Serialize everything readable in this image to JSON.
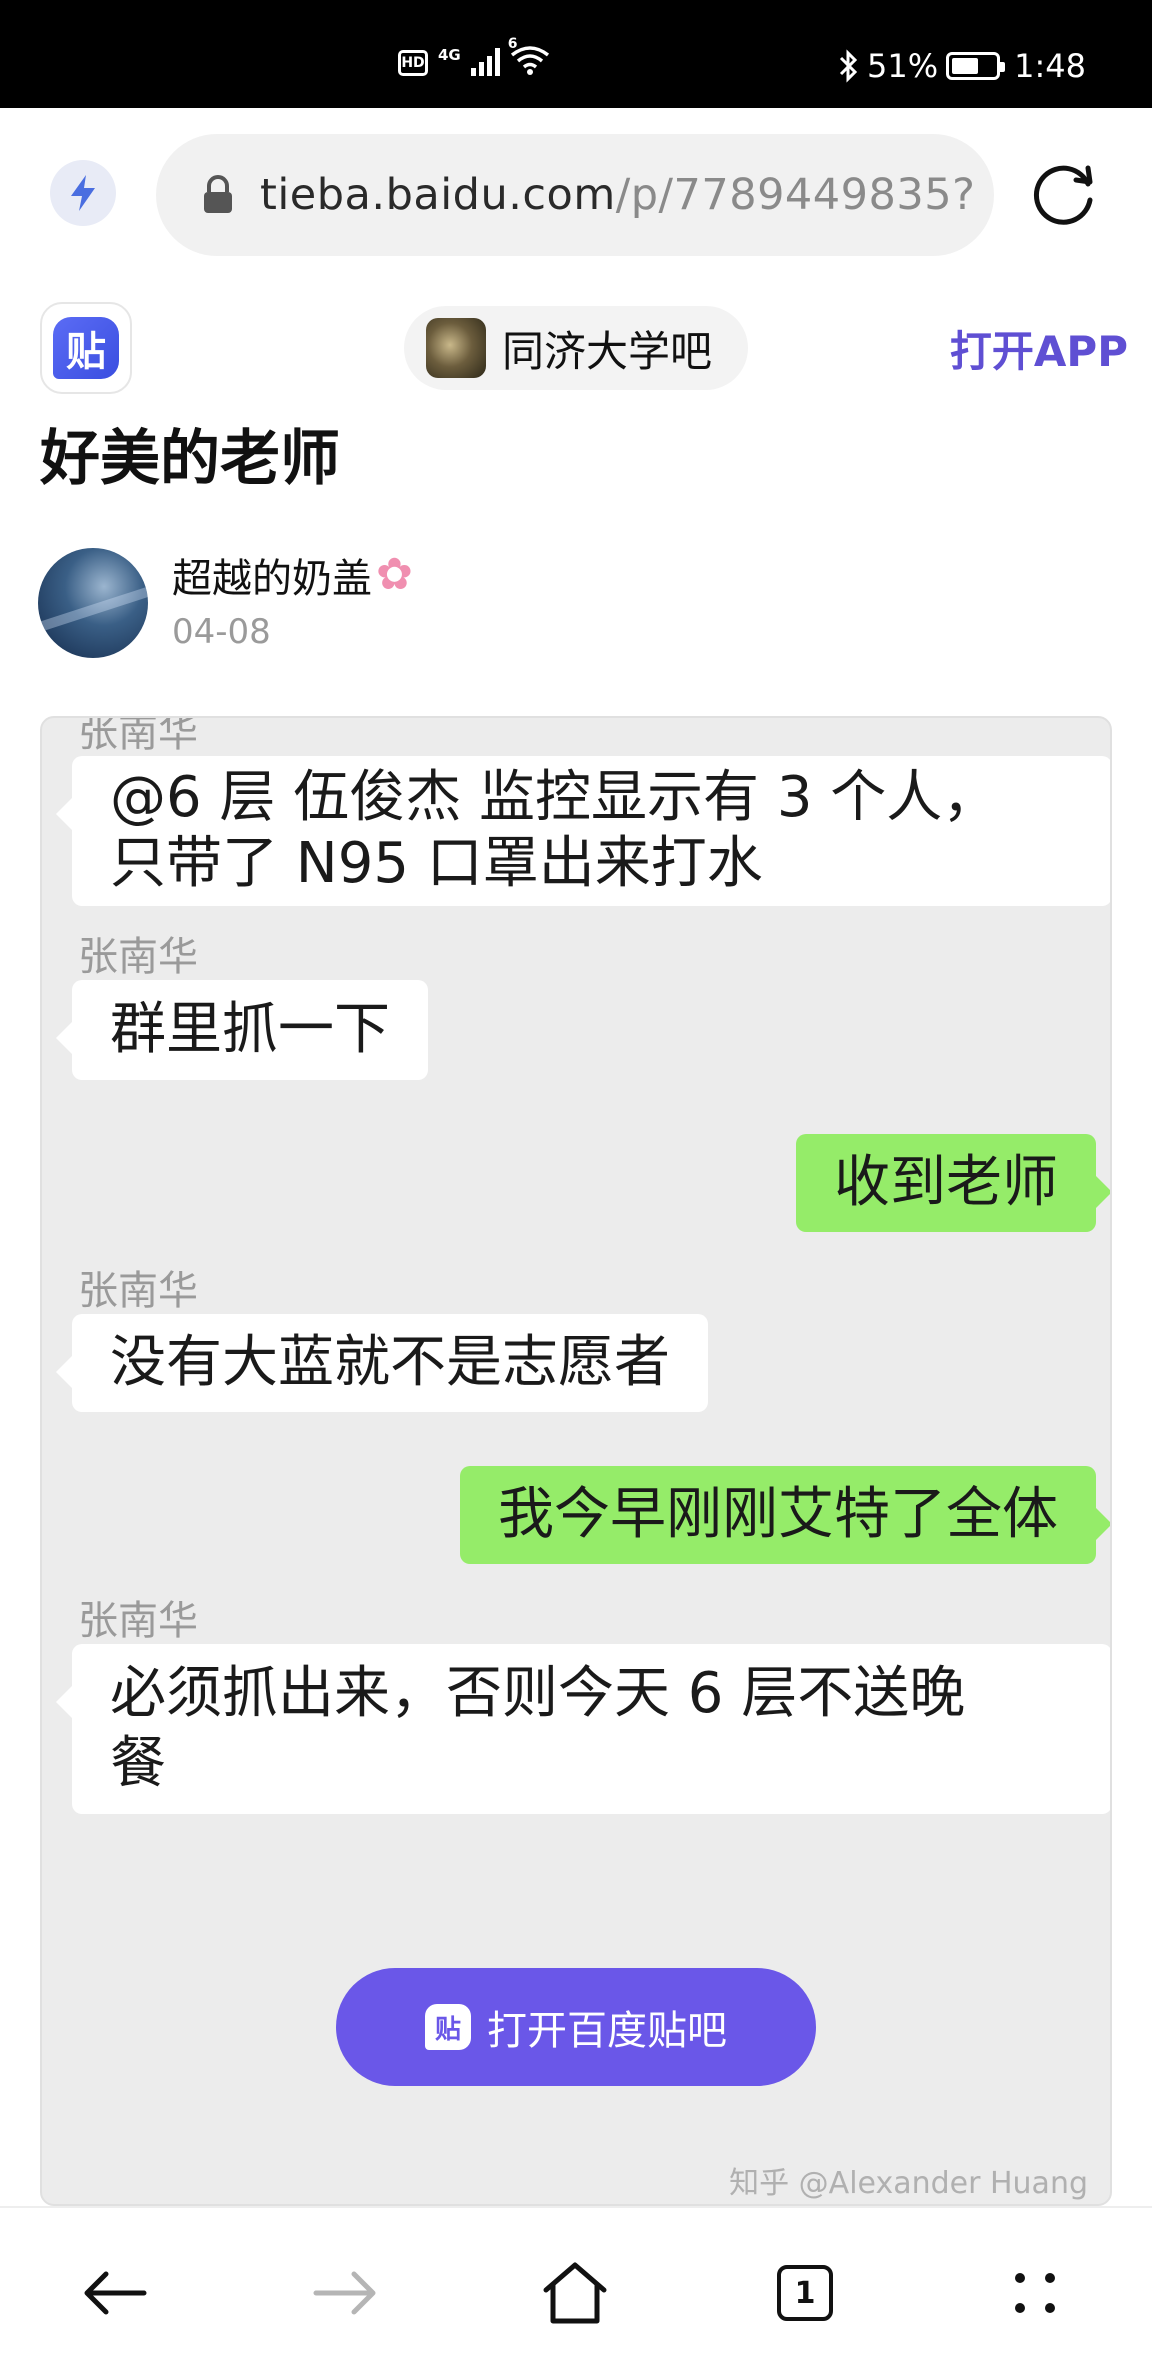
{
  "status_bar": {
    "hd": "HD",
    "network": "4G",
    "wifi_badge": "6",
    "battery": "51%",
    "time": "1:48"
  },
  "browser": {
    "url_host": "tieba.baidu.com",
    "url_path": "/p/7789449835?"
  },
  "forum": {
    "logo_char": "贴",
    "name": "同济大学吧",
    "open_app": "打开APP"
  },
  "post": {
    "title": "好美的老师",
    "author": "超越的奶盖",
    "date": "04-08"
  },
  "chat": {
    "top_sender_cut": "张南华",
    "messages": [
      {
        "side": "left",
        "lines": [
          "@6 层 伍俊杰  监控显示有 3 个人，",
          "只带了 N95 口罩出来打水"
        ]
      },
      {
        "side": "left",
        "sender": "张南华",
        "text": "群里抓一下"
      },
      {
        "side": "right",
        "text": "收到老师"
      },
      {
        "side": "left",
        "sender": "张南华",
        "text": "没有大蓝就不是志愿者"
      },
      {
        "side": "right",
        "text": "我今早刚刚艾特了全体"
      },
      {
        "side": "left",
        "sender": "张南华",
        "lines": [
          "必须抓出来，否则今天 6 层不送晚",
          "餐"
        ]
      }
    ],
    "watermark": "知乎 @Alexander Huang"
  },
  "floating_button": {
    "label": "打开百度贴吧",
    "icon_char": "贴"
  },
  "bottom_nav": {
    "tab_count": "1"
  }
}
